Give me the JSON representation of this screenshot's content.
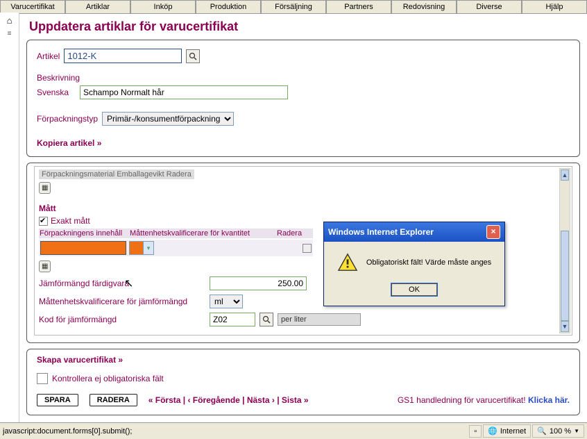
{
  "menu": [
    "Varucertifikat",
    "Artiklar",
    "Inköp",
    "Produktion",
    "Försäljning",
    "Partners",
    "Redovisning",
    "Diverse",
    "Hjälp"
  ],
  "page_title": "Uppdatera artiklar för varucertifikat",
  "form": {
    "artikel_label": "Artikel",
    "artikel_value": "1012-K",
    "beskrivning_label": "Beskrivning",
    "svenska_label": "Svenska",
    "svenska_value": "Schampo Normalt hår",
    "forpackningstyp_label": "Förpackningstyp",
    "forpackningstyp_value": "Primär-/konsumentförpackning",
    "kopiera_link": "Kopiera artikel »"
  },
  "panel2": {
    "greyed_header": "Förpackningsmaterial Emballagevikt Radera",
    "matt_header": "Mått",
    "exakt_label": "Exakt mått",
    "col1": "Förpackningens innehåll",
    "col2": "Måttenhetskvalificerare för kvantitet",
    "col3": "Radera",
    "jamformangd_label": "Jämförmängd färdigvara",
    "jamformangd_value": "250.00",
    "kvalificerare_label": "Måttenhetskvalificerare för jämförmängd",
    "kvalificerare_value": "ml",
    "kod_label": "Kod för jämförmängd",
    "kod_value": "Z02",
    "kod_text": "per liter"
  },
  "bottom": {
    "skapa_link": "Skapa varucertifikat »",
    "kontrollera_label": "Kontrollera ej obligatoriska fält",
    "spara": "SPARA",
    "radera": "RADERA",
    "pager": "« Första  |  ‹ Föregående  |  Nästa ›  |  Sista »",
    "gs1_text": "GS1 handledning för varucertifikat!",
    "gs1_click": "Klicka här."
  },
  "status": {
    "left": "javascript:document.forms[0].submit();",
    "internet": "Internet",
    "zoom": "100 %"
  },
  "dialog": {
    "title": "Windows Internet Explorer",
    "message": "Obligatoriskt fält! Värde måste anges",
    "ok": "OK"
  }
}
